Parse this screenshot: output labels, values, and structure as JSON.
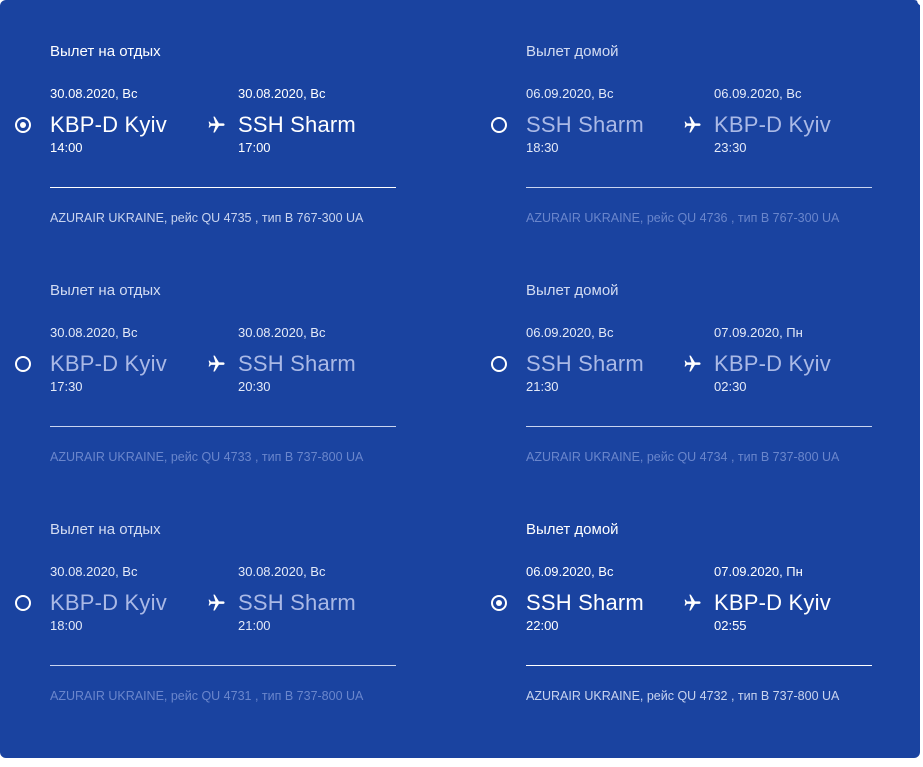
{
  "colors": {
    "panel": "#1a43a0",
    "active_text": "#ffffff",
    "muted_city": "#aab9e6",
    "muted_airline": "#6a86cc"
  },
  "outbound": [
    {
      "label": "Вылет на отдых",
      "selected": true,
      "dep_date": "30.08.2020, Вс",
      "arr_date": "30.08.2020, Вс",
      "from": "KBP-D Kyiv",
      "to": "SSH Sharm",
      "dep_time": "14:00",
      "arr_time": "17:00",
      "airline": "AZURAIR UKRAINE, рейс QU 4735 , тип B 767-300 UA"
    },
    {
      "label": "Вылет на отдых",
      "selected": false,
      "dep_date": "30.08.2020, Вс",
      "arr_date": "30.08.2020, Вс",
      "from": "KBP-D Kyiv",
      "to": "SSH Sharm",
      "dep_time": "17:30",
      "arr_time": "20:30",
      "airline": "AZURAIR UKRAINE, рейс QU 4733 , тип B 737-800 UA"
    },
    {
      "label": "Вылет на отдых",
      "selected": false,
      "dep_date": "30.08.2020, Вс",
      "arr_date": "30.08.2020, Вс",
      "from": "KBP-D Kyiv",
      "to": "SSH Sharm",
      "dep_time": "18:00",
      "arr_time": "21:00",
      "airline": "AZURAIR UKRAINE, рейс QU 4731 , тип B 737-800 UA"
    }
  ],
  "return": [
    {
      "label": "Вылет домой",
      "selected": false,
      "dep_date": "06.09.2020, Вс",
      "arr_date": "06.09.2020, Вс",
      "from": "SSH Sharm",
      "to": "KBP-D Kyiv",
      "dep_time": "18:30",
      "arr_time": "23:30",
      "airline": "AZURAIR UKRAINE, рейс QU 4736 , тип B 767-300 UA"
    },
    {
      "label": "Вылет домой",
      "selected": false,
      "dep_date": "06.09.2020, Вс",
      "arr_date": "07.09.2020, Пн",
      "from": "SSH Sharm",
      "to": "KBP-D Kyiv",
      "dep_time": "21:30",
      "arr_time": "02:30",
      "airline": "AZURAIR UKRAINE, рейс QU 4734 , тип B 737-800 UA"
    },
    {
      "label": "Вылет домой",
      "selected": true,
      "dep_date": "06.09.2020, Вс",
      "arr_date": "07.09.2020, Пн",
      "from": "SSH Sharm",
      "to": "KBP-D Kyiv",
      "dep_time": "22:00",
      "arr_time": "02:55",
      "airline": "AZURAIR UKRAINE, рейс QU 4732 , тип B 737-800 UA"
    }
  ],
  "icons": {
    "plane": "airplane-icon",
    "radio": "radio-button"
  }
}
